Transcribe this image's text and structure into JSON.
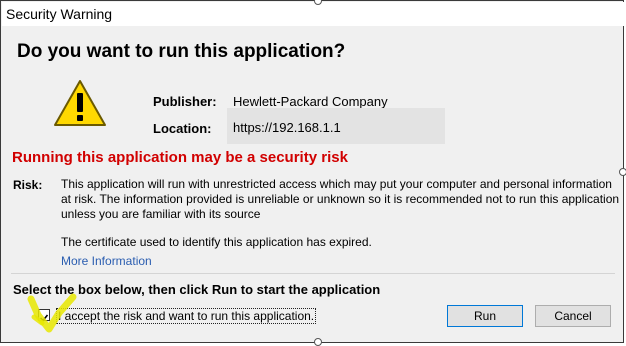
{
  "window": {
    "title": "Security Warning"
  },
  "dialog": {
    "question": "Do you want to run this application?",
    "icon": "warning-triangle-icon",
    "publisher_label": "Publisher:",
    "publisher_value": "Hewlett-Packard Company",
    "location_label": "Location:",
    "location_value": "https://192.168.1.1",
    "risk_heading": "Running this application may be a security risk",
    "risk_label": "Risk:",
    "risk_text": "This application will run with unrestricted access which may put your computer and personal information at risk. The information provided is unreliable or unknown so it is recommended not to run this application unless you are familiar with its source",
    "cert_text": "The certificate used to identify this application has expired.",
    "more_info": "More Information",
    "select_text": "Select the box below, then click Run to start the application",
    "accept_label": "I accept the risk and want to run this application.",
    "accept_checked": true,
    "run_label": "Run",
    "cancel_label": "Cancel"
  },
  "colors": {
    "risk_red": "#d10000",
    "link_blue": "#2a5db0",
    "highlight": "#e8e800",
    "warning_yellow": "#ffd800"
  }
}
